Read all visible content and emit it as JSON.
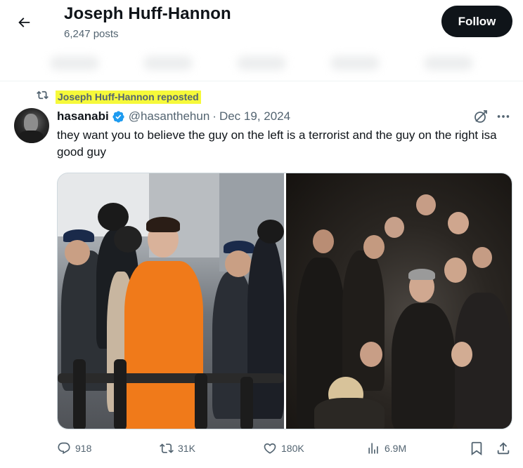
{
  "header": {
    "profile_name": "Joseph Huff-Hannon",
    "post_count": "6,247 posts",
    "follow_label": "Follow"
  },
  "repost": {
    "text": "Joseph Huff-Hannon reposted",
    "highlight_color": "#f6f93a"
  },
  "tweet": {
    "author_name": "hasanabi",
    "handle": "@hasanthehun",
    "separator": "·",
    "date": "Dec 19, 2024",
    "text": "they want you to believe the guy on the left is a terrorist and the guy on the right isa good guy",
    "verified_color": "#1d9bf0"
  },
  "stats": {
    "replies": "918",
    "reposts": "31K",
    "likes": "180K",
    "views": "6.9M"
  },
  "icons": [
    "back-arrow-icon",
    "repost-icon",
    "verified-badge-icon",
    "grok-icon",
    "more-icon",
    "reply-icon",
    "retweet-icon",
    "like-icon",
    "views-icon",
    "bookmark-icon",
    "share-icon"
  ],
  "colors": {
    "text_primary": "#0f1419",
    "text_secondary": "#536471",
    "follow_bg": "#0f1419"
  }
}
